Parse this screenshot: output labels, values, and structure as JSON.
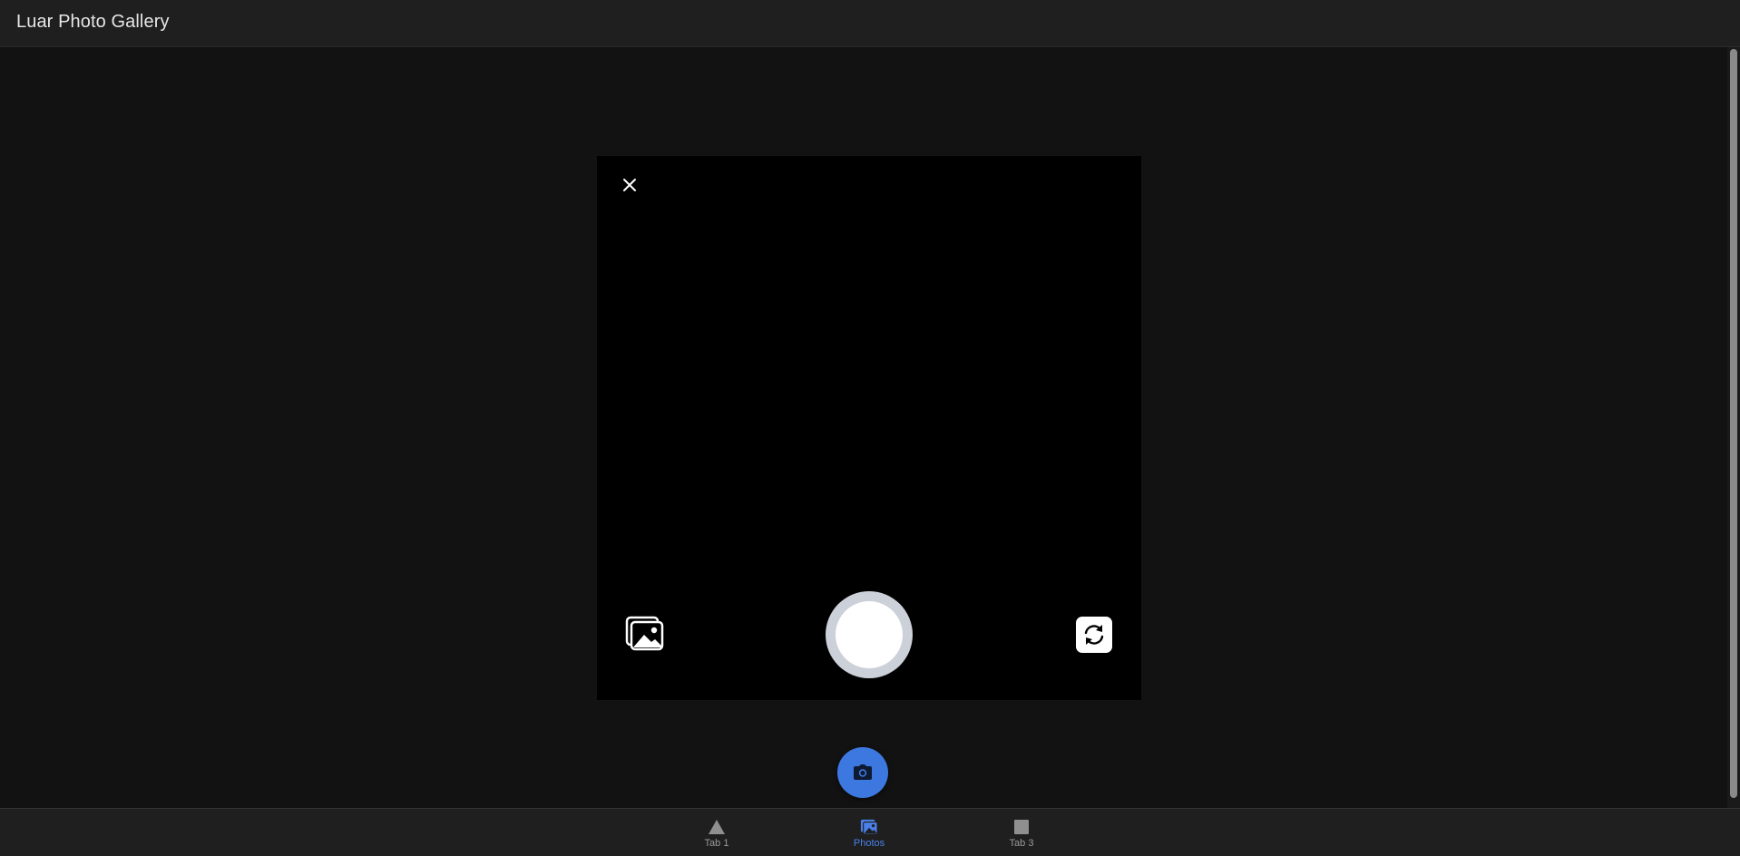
{
  "header": {
    "title": "Luar Photo Gallery"
  },
  "camera": {
    "close_icon": "close-icon",
    "gallery_icon": "images-icon",
    "shutter_icon": "shutter-icon",
    "flip_icon": "camera-reverse-icon"
  },
  "fab": {
    "icon": "camera-icon",
    "color": "#3d78e0"
  },
  "tabs": [
    {
      "label": "Tab 1",
      "icon": "triangle-icon",
      "active": false
    },
    {
      "label": "Photos",
      "icon": "images-icon",
      "active": true
    },
    {
      "label": "Tab 3",
      "icon": "square-icon",
      "active": false
    }
  ],
  "colors": {
    "accent": "#4a80e8",
    "background": "#121212",
    "toolbar": "#1f1f1f"
  }
}
